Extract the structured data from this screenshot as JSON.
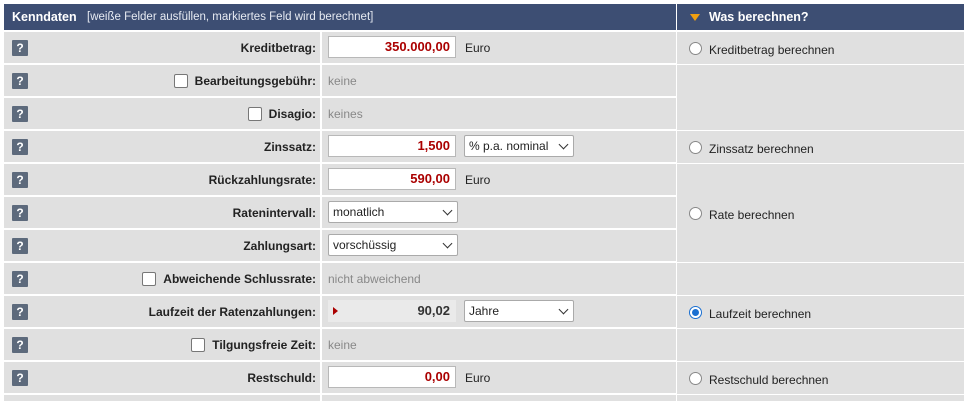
{
  "header": {
    "title": "Kenndaten",
    "subtitle": "[weiße Felder ausfüllen, markiertes Feld wird berechnet]",
    "right_title": "Was berechnen?"
  },
  "help_glyph": "?",
  "rows": {
    "kreditbetrag": {
      "label": "Kreditbetrag:",
      "value": "350.000,00",
      "unit": "Euro"
    },
    "bearbeitungsgebuehr": {
      "label": "Bearbeitungsgebühr:",
      "value": "keine"
    },
    "disagio": {
      "label": "Disagio:",
      "value": "keines"
    },
    "zinssatz": {
      "label": "Zinssatz:",
      "value": "1,500",
      "select": "% p.a. nominal"
    },
    "rueckzahlungsrate": {
      "label": "Rückzahlungsrate:",
      "value": "590,00",
      "unit": "Euro"
    },
    "ratenintervall": {
      "label": "Ratenintervall:",
      "select": "monatlich"
    },
    "zahlungsart": {
      "label": "Zahlungsart:",
      "select": "vorschüssig"
    },
    "schlussrate": {
      "label": "Abweichende Schlussrate:",
      "value": "nicht abweichend"
    },
    "laufzeit": {
      "label": "Laufzeit der Ratenzahlungen:",
      "value": "90,02",
      "select": "Jahre"
    },
    "tilgungsfrei": {
      "label": "Tilgungsfreie Zeit:",
      "value": "keine"
    },
    "restschuld": {
      "label": "Restschuld:",
      "value": "0,00",
      "unit": "Euro"
    }
  },
  "calculate": {
    "options": [
      {
        "label": "Kreditbetrag berechnen",
        "checked": false
      },
      {
        "label": "Zinssatz berechnen",
        "checked": false
      },
      {
        "label": "Rate berechnen",
        "checked": false
      },
      {
        "label": "Laufzeit berechnen",
        "checked": true
      },
      {
        "label": "Restschuld berechnen",
        "checked": false
      }
    ]
  },
  "colors": {
    "header": "#3d4e73",
    "row": "#e0e0e0",
    "value": "#aa0000",
    "accent": "#f0a010",
    "radio": "#1a6fd1"
  }
}
